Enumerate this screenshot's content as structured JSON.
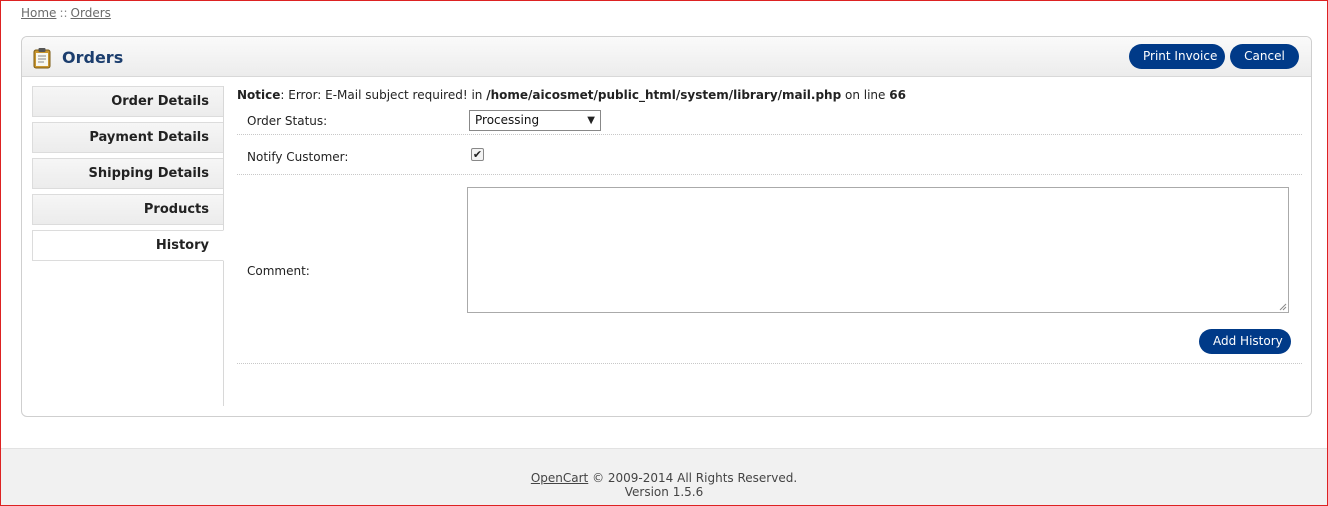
{
  "breadcrumb": {
    "home": "Home",
    "separator": "::",
    "orders": "Orders"
  },
  "header": {
    "title": "Orders",
    "icon": "clipboard-icon",
    "print_invoice_label": "Print Invoice",
    "cancel_label": "Cancel"
  },
  "tabs": [
    {
      "label": "Order Details"
    },
    {
      "label": "Payment Details"
    },
    {
      "label": "Shipping Details"
    },
    {
      "label": "Products"
    },
    {
      "label": "History",
      "selected": true
    }
  ],
  "notice": {
    "label": "Notice",
    "message": ": Error: E-Mail subject required! in ",
    "path": "/home/aicosmet/public_html/system/library/mail.php",
    "on_line_text": " on line ",
    "line": "66"
  },
  "form": {
    "order_status_label": "Order Status:",
    "order_status_value": "Processing",
    "notify_label": "Notify Customer:",
    "notify_checked": true,
    "comment_label": "Comment:",
    "comment_value": "",
    "add_history_label": "Add History"
  },
  "footer": {
    "brand": "OpenCart",
    "copyright": " © 2009-2014 All Rights Reserved.",
    "version": "Version 1.5.6"
  },
  "colors": {
    "button_bg": "#003a88",
    "title_text": "#1c3e6e",
    "frame_border": "#dd2222"
  }
}
